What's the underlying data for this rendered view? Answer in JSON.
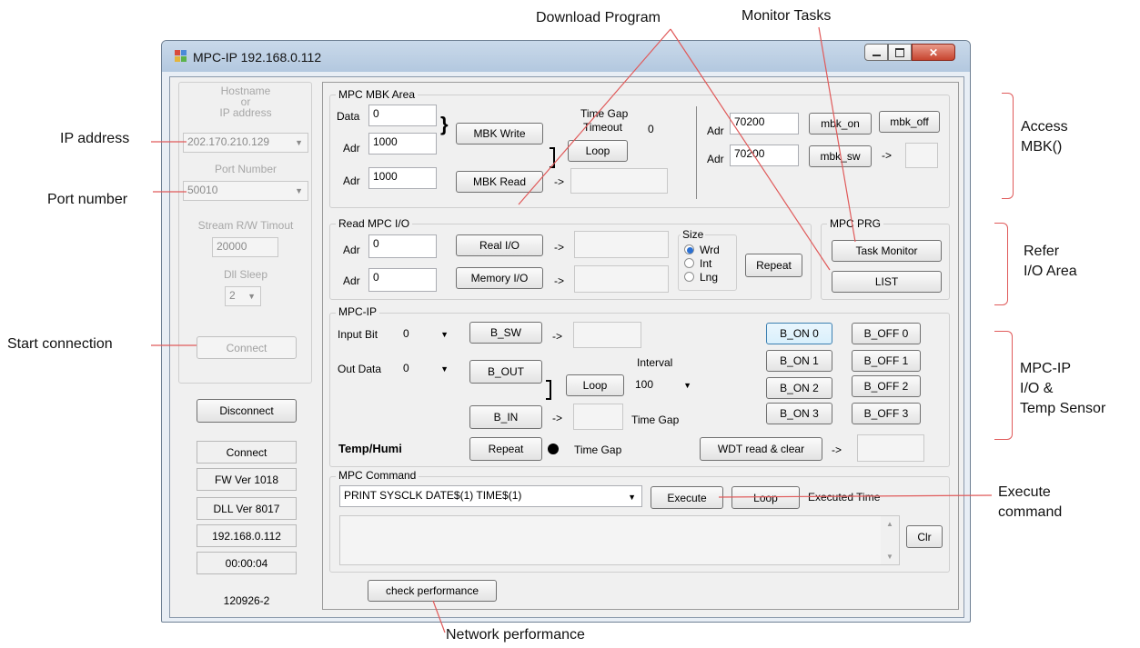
{
  "window": {
    "title": "MPC-IP 192.168.0.112"
  },
  "connection": {
    "hostname_label": "Hostname\nor\nIP address",
    "ip_value": "202.170.210.129",
    "port_label": "Port Number",
    "port_value": "50010",
    "stream_label": "Stream R/W Timout",
    "stream_value": "20000",
    "dll_sleep_label": "Dll Sleep",
    "dll_sleep_value": "2",
    "connect_button": "Connect"
  },
  "status": {
    "disconnect_button": "Disconnect",
    "state": "Connect",
    "fw_ver": "FW Ver 1018",
    "dll_ver": "DLL Ver 8017",
    "ip": "192.168.0.112",
    "time": "00:00:04",
    "build": "120926-2"
  },
  "mbk": {
    "group_label": "MPC MBK Area",
    "data_label": "Data",
    "data_value": "0",
    "adr_label": "Adr",
    "write_adr": "1000",
    "read_adr": "1000",
    "write_button": "MBK Write",
    "read_button": "MBK Read",
    "time_gap_label": "Time Gap",
    "timeout_label": "Timeout",
    "timeout_value": "0",
    "loop_button": "Loop",
    "arrow": "->",
    "on_adr": "70200",
    "sw_adr": "70200",
    "on_button": "mbk_on",
    "off_button": "mbk_off",
    "sw_button": "mbk_sw"
  },
  "io": {
    "group_label": "Read MPC I/O",
    "adr_label": "Adr",
    "real_adr": "0",
    "mem_adr": "0",
    "real_button": "Real I/O",
    "mem_button": "Memory I/O",
    "arrow": "->",
    "size_label": "Size",
    "sizes": [
      "Wrd",
      "Int",
      "Lng"
    ],
    "repeat_button": "Repeat"
  },
  "prg": {
    "group_label": "MPC PRG",
    "task_button": "Task Monitor",
    "list_button": "LIST"
  },
  "mpcip": {
    "group_label": "MPC-IP",
    "input_bit_label": "Input Bit",
    "input_bit_value": "0",
    "out_data_label": "Out Data",
    "out_data_value": "0",
    "bsw_button": "B_SW",
    "bout_button": "B_OUT",
    "bin_button": "B_IN",
    "loop_button": "Loop",
    "interval_label": "Interval",
    "interval_value": "100",
    "time_gap_label": "Time Gap",
    "temp_label": "Temp/Humi",
    "repeat_button": "Repeat",
    "time_gap_label2": "Time Gap",
    "wdt_button": "WDT read & clear",
    "arrow": "->",
    "bon_buttons": [
      "B_ON 0",
      "B_ON 1",
      "B_ON 2",
      "B_ON 3"
    ],
    "boff_buttons": [
      "B_OFF 0",
      "B_OFF 1",
      "B_OFF 2",
      "B_OFF 3"
    ]
  },
  "command": {
    "group_label": "MPC Command",
    "command_value": "PRINT SYSCLK DATE$(1) TIME$(1)",
    "execute_button": "Execute",
    "loop_button": "Loop",
    "executed_time_label": "Executed Time",
    "clr_button": "Clr"
  },
  "perf_button": "check performance",
  "annotations": {
    "ip_address": "IP address",
    "port_number": "Port number",
    "start_connection": "Start connection",
    "download_program": "Download Program",
    "monitor_tasks": "Monitor Tasks",
    "access_mbk_1": "Access",
    "access_mbk_2": "MBK()",
    "refer_io_1": "Refer",
    "refer_io_2": "I/O Area",
    "mpcip_io_1": "MPC-IP",
    "mpcip_io_2": "I/O &",
    "mpcip_io_3": "Temp Sensor",
    "execute_command_1": "Execute",
    "execute_command_2": "command",
    "network_performance": "Network performance"
  },
  "colors": {
    "annotation_line": "#e05a5a",
    "title_bar": "#c9d9ea",
    "client_bg": "#f0f0f0"
  }
}
